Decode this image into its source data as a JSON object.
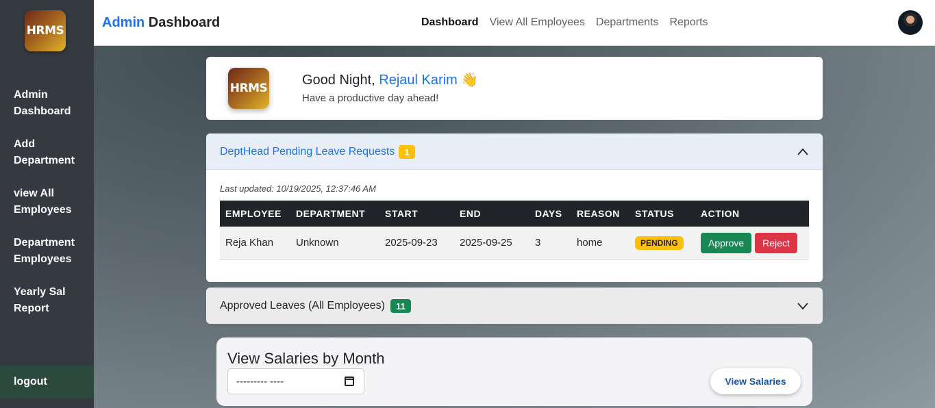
{
  "app": {
    "logo_text": "HRMS",
    "brand_accent": "Admin",
    "brand_rest": " Dashboard"
  },
  "sidebar": {
    "items": [
      {
        "label": "Admin Dashboard"
      },
      {
        "label": "Add Department"
      },
      {
        "label": "view All Employees"
      },
      {
        "label": "Department Employees"
      },
      {
        "label": "Yearly Sal Report"
      }
    ],
    "logout": "logout"
  },
  "topnav": {
    "links": [
      "Dashboard",
      "View All Employees",
      "Departments",
      "Reports"
    ],
    "active": "Dashboard"
  },
  "greeting": {
    "prefix": "Good Night, ",
    "name": "Rejaul Karim",
    "emoji": "👋",
    "subtitle": "Have a productive day ahead!"
  },
  "pending": {
    "title": "DeptHead Pending Leave Requests",
    "count": "1",
    "last_updated": "Last updated: 10/19/2025, 12:37:46 AM",
    "columns": [
      "EMPLOYEE",
      "DEPARTMENT",
      "START",
      "END",
      "DAYS",
      "REASON",
      "STATUS",
      "ACTION"
    ],
    "rows": [
      {
        "employee": "Reja Khan",
        "department": "Unknown",
        "start": "2025-09-23",
        "end": "2025-09-25",
        "days": "3",
        "reason": "home",
        "status": "PENDING",
        "approve_label": "Approve",
        "reject_label": "Reject"
      }
    ]
  },
  "approved": {
    "title": "Approved Leaves (All Employees)",
    "count": "11"
  },
  "salary": {
    "title": "View Salaries by Month",
    "month_value": "--------- ----",
    "button_label": "View Salaries"
  },
  "colors": {
    "accent": "#1a73e8",
    "sidebar_bg": "#343a40",
    "logout_bg": "#2b4a3d",
    "warning": "#ffc107",
    "success": "#198754",
    "danger": "#dc3545"
  }
}
